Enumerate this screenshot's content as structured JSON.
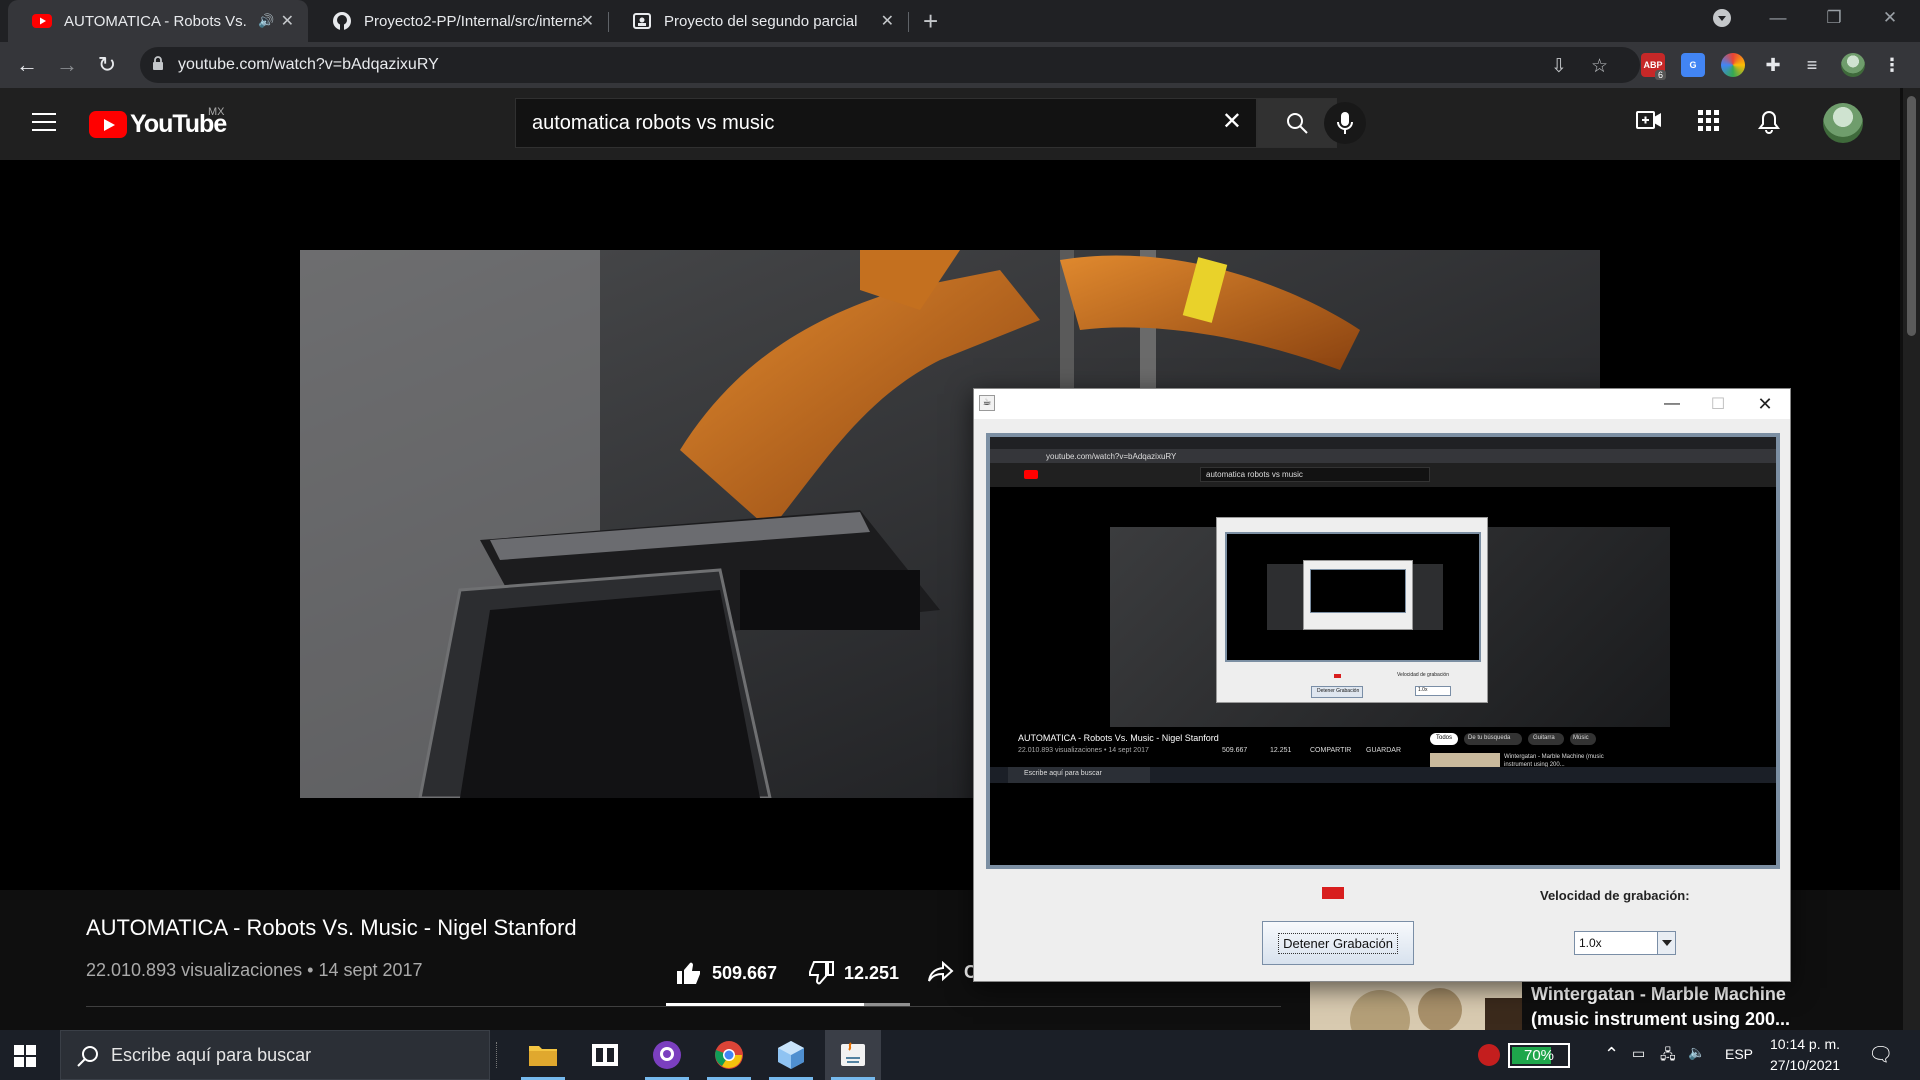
{
  "browser": {
    "tabs": [
      {
        "title": "AUTOMATICA - Robots Vs. Music - Nigel Stanford",
        "active": true
      },
      {
        "title": "Proyecto2-PP/Internal/src/internal",
        "active": false
      },
      {
        "title": "Proyecto del segundo parcial",
        "active": false
      }
    ],
    "url": "youtube.com/watch?v=bAdqazixuRY",
    "extension_badge": "6"
  },
  "youtube": {
    "logo_text": "YouTube",
    "country_code": "MX",
    "search_query": "automatica robots vs music",
    "video": {
      "title": "AUTOMATICA - Robots Vs. Music - Nigel Stanford",
      "meta": "22.010.893 visualizaciones • 14 sept 2017",
      "likes": "509.667",
      "dislikes": "12.251",
      "share_partial": "C",
      "like_ratio": 0.81
    },
    "recommendation": {
      "title": "Wintergatan - Marble Machine (music instrument using 200..."
    }
  },
  "recorder": {
    "speed_label": "Velocidad de grabación:",
    "stop_button": "Detener Grabación",
    "speed_value": "1.0x",
    "preview": {
      "url": "youtube.com/watch?v=bAdqazixuRY",
      "search": "automatica robots vs music",
      "video_title": "AUTOMATICA - Robots Vs. Music - Nigel Stanford",
      "video_meta": "22.010.893 visualizaciones • 14 sept 2017",
      "likes": "509.667",
      "dislikes": "12.251",
      "share": "COMPARTIR",
      "save": "GUARDAR",
      "chips": [
        "Todos",
        "De tu búsqueda",
        "Guitarra",
        "Músic"
      ],
      "rec_title": "Wintergatan - Marble Machine (music instrument using 200...",
      "taskbar_search": "Escribe aquí para buscar",
      "speed_label": "Velocidad de grabación",
      "stop_button": "Detener Grabación",
      "speed_value": "1.0x"
    }
  },
  "taskbar": {
    "search_placeholder": "Escribe aquí para buscar",
    "battery": "70%",
    "language": "ESP",
    "time": "10:14 p. m.",
    "date": "27/10/2021"
  }
}
